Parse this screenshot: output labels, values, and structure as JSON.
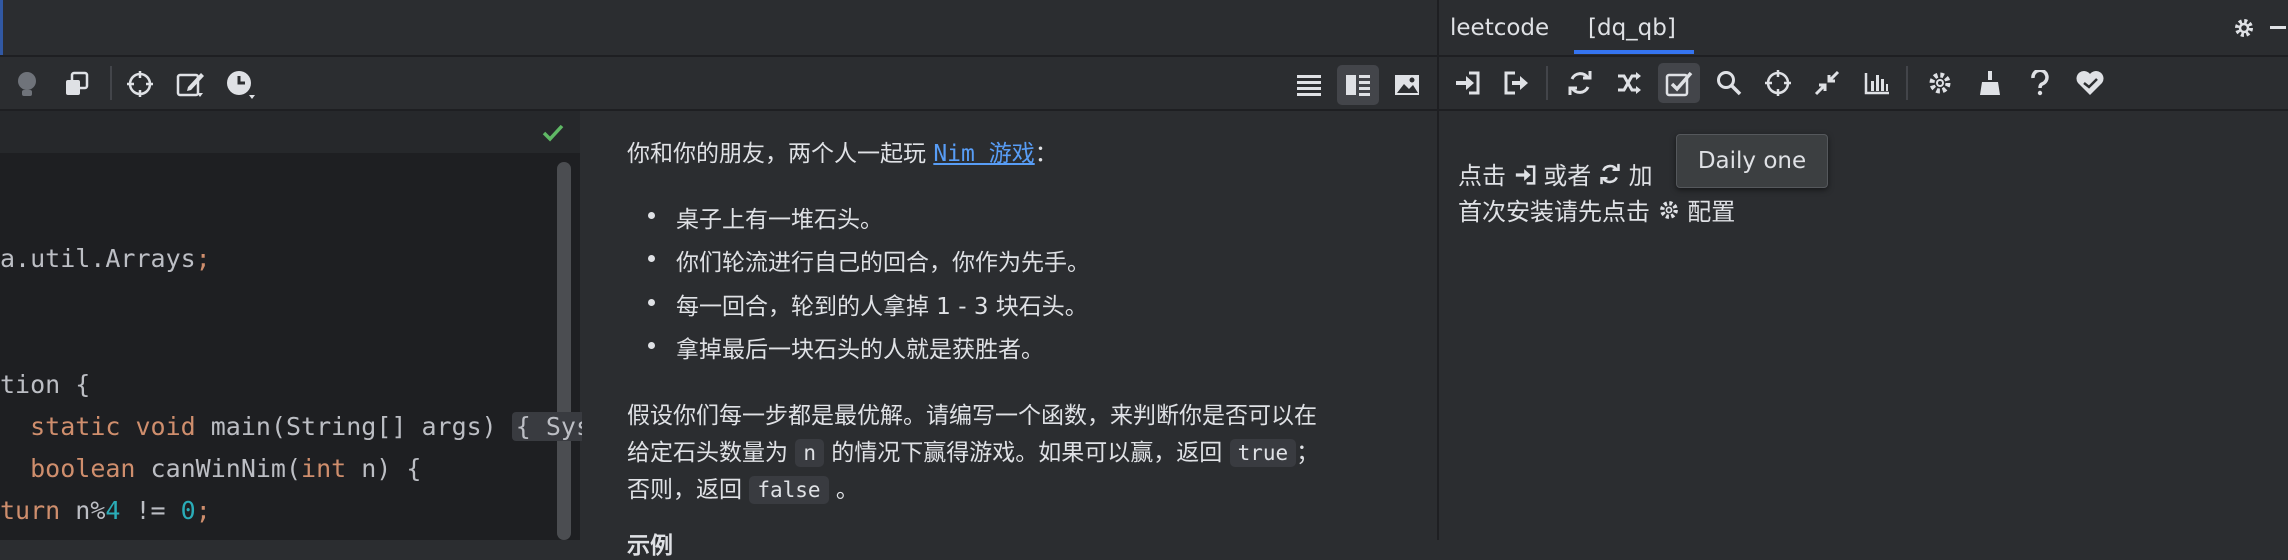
{
  "tool_window": {
    "tabs": [
      "leetcode",
      "[dq_qb]"
    ],
    "tooltip": "Daily one",
    "hint_line1_a": "点击",
    "hint_line1_b": "或者",
    "hint_line1_c": "加",
    "hint_line2_a": "首次安装请先点击",
    "hint_line2_b": "配置"
  },
  "editor": {
    "lines": {
      "l1": "a.util.Arrays",
      "l1_semi": ";",
      "l2": "tion {",
      "l3_kw1": "static",
      "l3_kw2": "void",
      "l3_rest": " main(String[] args) ",
      "l3_fold": "{ Sys",
      "l4_kw": "boolean",
      "l4_rest": " canWinNim(",
      "l4_kw2": "int",
      "l4_rest2": " n) {",
      "l5_kw": "turn",
      "l5_rest": " n%",
      "l5_num": "4",
      "l5_rest2": " != ",
      "l5_num2": "0",
      "l5_semi": ";"
    }
  },
  "description": {
    "intro_before": "你和你的朋友，两个人一起玩 ",
    "intro_link": "Nim 游戏",
    "intro_after": "：",
    "bullets": [
      "桌子上有一堆石头。",
      "你们轮流进行自己的回合，你作为先手。",
      "每一回合，轮到的人拿掉 1 - 3 块石头。",
      "拿掉最后一块石头的人就是获胜者。"
    ],
    "para1": "假设你们每一步都是最优解。请编写一个函数，来判断你是否可以在",
    "para2_a": "给定石头数量为",
    "para2_chip": "n",
    "para2_b": "的情况下赢得游戏。如果可以赢，返回",
    "para2_chip2": "true",
    "para2_c": "；",
    "para3_a": "否则，返回",
    "para3_chip": "false",
    "para3_b": "。",
    "next_heading": "示例"
  },
  "colors": {
    "accent": "#3574f0",
    "link": "#589df6",
    "check": "#5fb865",
    "keyword": "#cf8e6d",
    "number": "#2aacb8"
  },
  "icons": {
    "left_toolbar": [
      "bulb-icon",
      "copy-icon",
      "target-icon",
      "edit-icon",
      "clock-icon"
    ],
    "view_modes": [
      "list-view-icon",
      "split-view-icon",
      "image-view-icon"
    ],
    "right_toolbar": [
      "login-icon",
      "logout-icon",
      "refresh-icon",
      "shuffle-icon",
      "daily-check-icon",
      "search-icon",
      "locate-icon",
      "collapse-icon",
      "chart-icon",
      "settings-icon",
      "clean-icon",
      "help-icon",
      "donate-heart-icon"
    ]
  }
}
